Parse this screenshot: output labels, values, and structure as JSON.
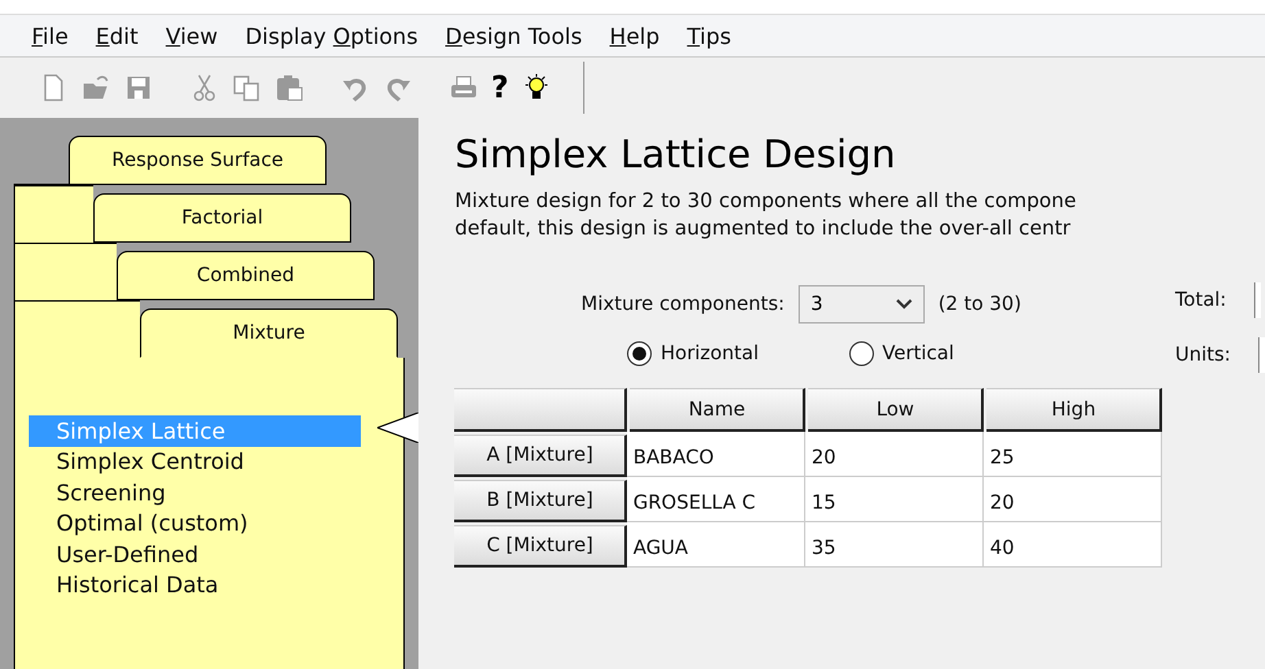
{
  "menu": [
    {
      "accel": "F",
      "after": "ile"
    },
    {
      "accel": "E",
      "after": "dit"
    },
    {
      "accel": "V",
      "after": "iew"
    },
    {
      "before": "Display ",
      "accel": "O",
      "after": "ptions"
    },
    {
      "accel": "D",
      "after": "esign Tools"
    },
    {
      "accel": "H",
      "after": "elp"
    },
    {
      "accel": "T",
      "after": "ips"
    }
  ],
  "toolbar": [
    {
      "kind": "new",
      "disabled": true
    },
    {
      "kind": "open",
      "disabled": true
    },
    {
      "kind": "save",
      "disabled": true
    },
    {
      "kind": "sep"
    },
    {
      "kind": "cut",
      "disabled": true
    },
    {
      "kind": "copy",
      "disabled": true
    },
    {
      "kind": "paste",
      "disabled": true
    },
    {
      "kind": "sep"
    },
    {
      "kind": "undo",
      "disabled": true
    },
    {
      "kind": "redo",
      "disabled": true
    },
    {
      "kind": "sep"
    },
    {
      "kind": "print",
      "disabled": true
    },
    {
      "kind": "help",
      "disabled": false,
      "label": "?"
    },
    {
      "kind": "tip"
    }
  ],
  "tabs": [
    {
      "label": "Response Surface",
      "selected": false
    },
    {
      "label": "Factorial",
      "selected": false
    },
    {
      "label": "Combined",
      "selected": false
    },
    {
      "label": "Mixture",
      "selected": true
    }
  ],
  "design_list": [
    {
      "label": "Simplex Lattice",
      "selected": true
    },
    {
      "label": "Simplex Centroid",
      "selected": false
    },
    {
      "label": "Screening",
      "selected": false
    },
    {
      "label": "Optimal (custom)",
      "selected": false
    },
    {
      "label": "User-Defined",
      "selected": false
    },
    {
      "label": "Historical Data",
      "selected": false
    }
  ],
  "title": "Simplex Lattice Design",
  "description": [
    "Mixture design for 2 to 30 components where all the compone",
    "default, this design is augmented to include the over-all centr"
  ],
  "components": {
    "label": "Mixture components:",
    "value": "3",
    "range": "(2 to 30)"
  },
  "total": {
    "label": "Total:"
  },
  "units": {
    "label": "Units:"
  },
  "orientation": [
    {
      "label": "Horizontal",
      "selected": true
    },
    {
      "label": "Vertical",
      "selected": false
    }
  ],
  "table": {
    "columns": [
      "Name",
      "Low",
      "High"
    ],
    "rows": [
      {
        "header": "A [Mixture]",
        "cells": [
          "BABACO",
          "20",
          "25"
        ]
      },
      {
        "header": "B [Mixture]",
        "cells": [
          "GROSELLA C",
          "15",
          "20"
        ]
      },
      {
        "header": "C [Mixture]",
        "cells": [
          "AGUA",
          "35",
          "40"
        ]
      }
    ]
  }
}
